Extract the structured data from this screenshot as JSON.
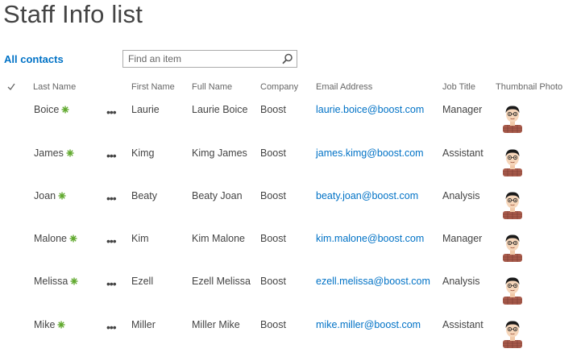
{
  "page": {
    "title": "Staff Info list"
  },
  "toolbar": {
    "view_label": "All contacts",
    "search_placeholder": "Find an item"
  },
  "columns": {
    "last_name": "Last Name",
    "first_name": "First Name",
    "full_name": "Full Name",
    "company": "Company",
    "email": "Email Address",
    "job_title": "Job Title",
    "thumbnail": "Thumbnail Photo"
  },
  "icons": {
    "check": "checkmark-icon",
    "search": "search-icon",
    "new": "new-item-icon",
    "menu": "ellipsis-icon",
    "thumbnail": "person-thumbnail-icon"
  },
  "colors": {
    "link": "#0072c6",
    "new_indicator": "#5fa82c",
    "title": "#444444"
  },
  "rows": [
    {
      "last": "Boice",
      "first": "Laurie",
      "full": "Laurie Boice",
      "company": "Boost",
      "email": "laurie.boice@boost.com",
      "job": "Manager"
    },
    {
      "last": "James",
      "first": "Kimg",
      "full": "Kimg James",
      "company": "Boost",
      "email": "james.kimg@boost.com",
      "job": "Assistant"
    },
    {
      "last": "Joan",
      "first": "Beaty",
      "full": "Beaty Joan",
      "company": "Boost",
      "email": "beaty.joan@boost.com",
      "job": "Analysis"
    },
    {
      "last": "Malone",
      "first": "Kim",
      "full": "Kim Malone",
      "company": "Boost",
      "email": "kim.malone@boost.com",
      "job": "Manager"
    },
    {
      "last": "Melissa",
      "first": "Ezell",
      "full": "Ezell Melissa",
      "company": "Boost",
      "email": "ezell.melissa@boost.com",
      "job": "Analysis"
    },
    {
      "last": "Mike",
      "first": "Miller",
      "full": "Miller Mike",
      "company": "Boost",
      "email": "mike.miller@boost.com",
      "job": "Assistant"
    }
  ]
}
